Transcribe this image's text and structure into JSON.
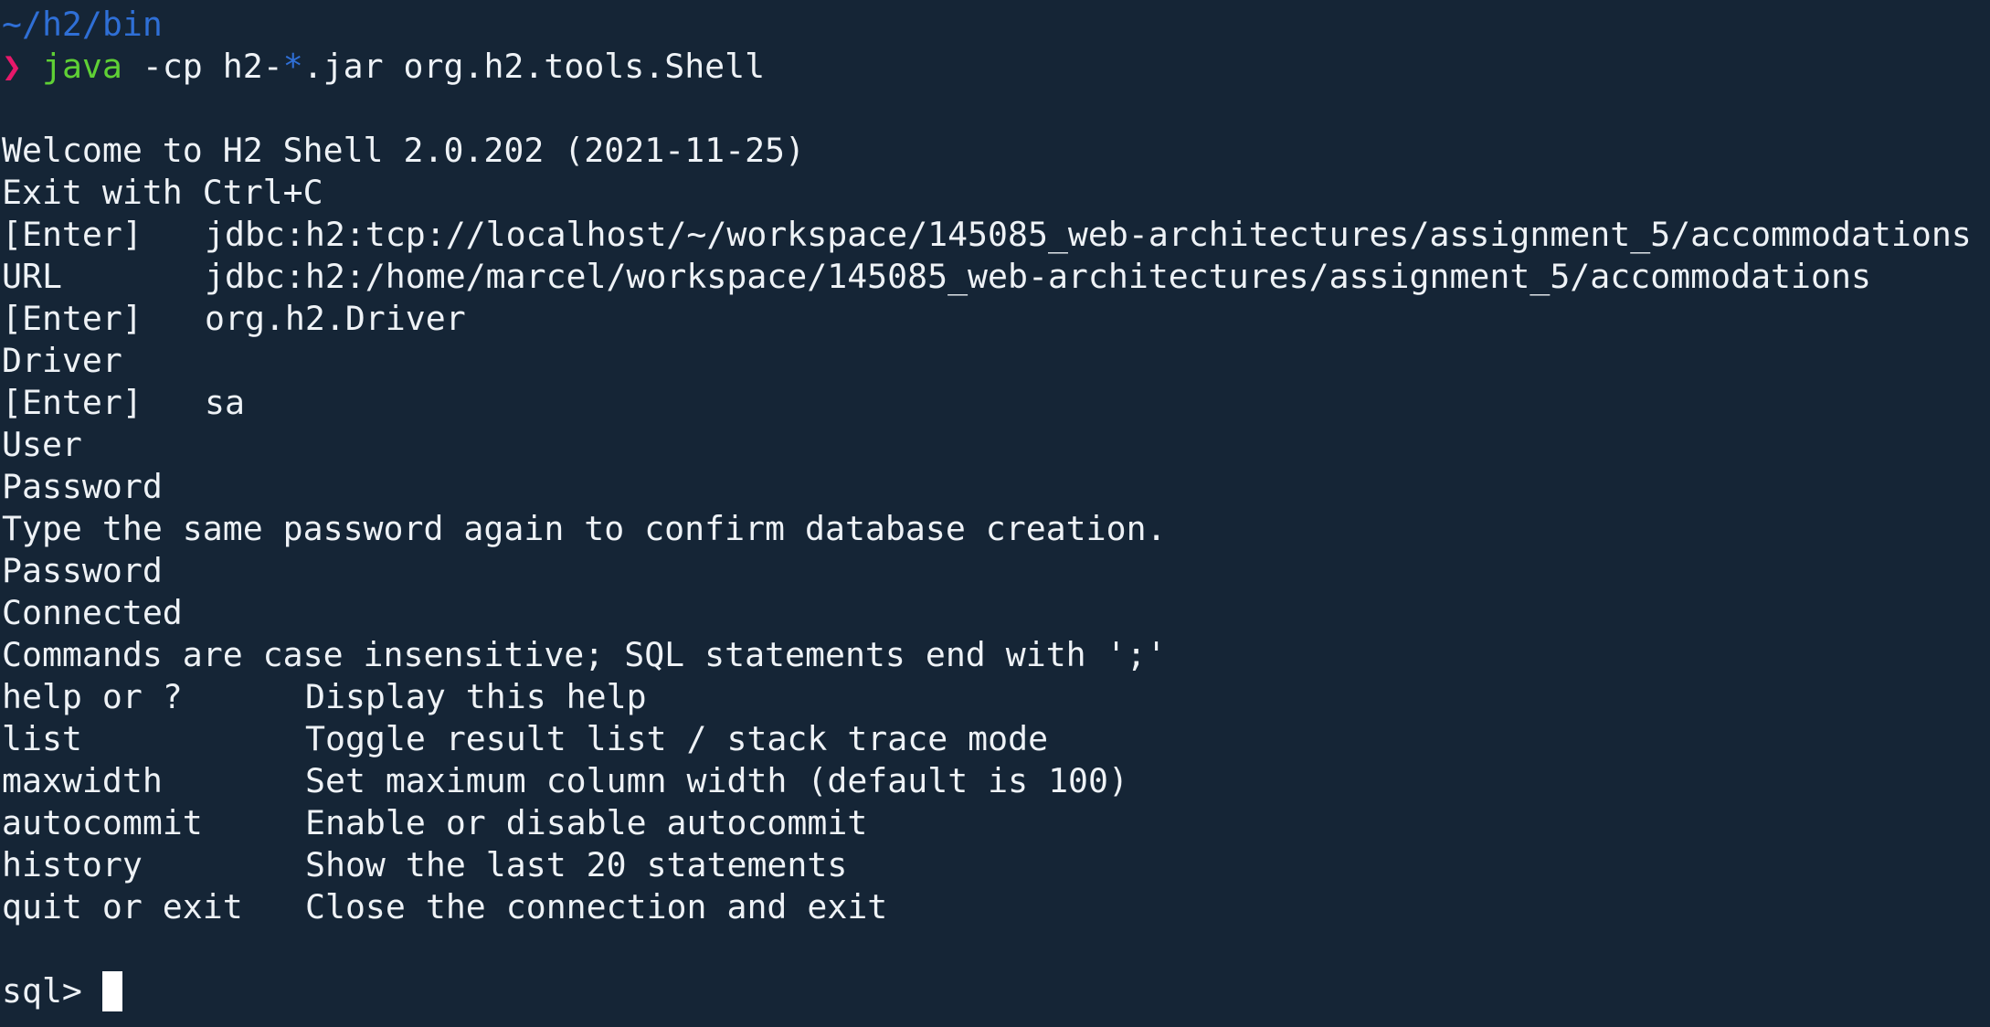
{
  "terminal": {
    "cwd": "~/h2/bin",
    "prompt_symbol": "❯",
    "command": {
      "program": "java",
      "args_before": " -cp h2-",
      "glob": "*",
      "args_after": ".jar org.h2.tools.Shell"
    },
    "output": {
      "welcome": "Welcome to H2 Shell 2.0.202 (2021-11-25)",
      "exit_hint": "Exit with Ctrl+C",
      "prompts": [
        {
          "label": "[Enter]",
          "value": "jdbc:h2:tcp://localhost/~/workspace/145085_web-architectures/assignment_5/accommodations"
        },
        {
          "label": "URL",
          "value": "jdbc:h2:/home/marcel/workspace/145085_web-architectures/assignment_5/accommodations"
        },
        {
          "label": "[Enter]",
          "value": "org.h2.Driver"
        },
        {
          "label": "Driver",
          "value": ""
        },
        {
          "label": "[Enter]",
          "value": "sa"
        },
        {
          "label": "User",
          "value": ""
        },
        {
          "label": "Password",
          "value": ""
        }
      ],
      "confirm_msg": "Type the same password again to confirm database creation.",
      "password2": "Password",
      "connected": "Connected",
      "commands_intro": "Commands are case insensitive; SQL statements end with ';'",
      "help_rows": [
        {
          "cmd": "help or ?",
          "desc": "Display this help"
        },
        {
          "cmd": "list",
          "desc": "Toggle result list / stack trace mode"
        },
        {
          "cmd": "maxwidth",
          "desc": "Set maximum column width (default is 100)"
        },
        {
          "cmd": "autocommit",
          "desc": "Enable or disable autocommit"
        },
        {
          "cmd": "history",
          "desc": "Show the last 20 statements"
        },
        {
          "cmd": "quit or exit",
          "desc": "Close the connection and exit"
        }
      ]
    },
    "sql_prompt": "sql> "
  },
  "colors": {
    "background": "#152536",
    "foreground": "#eef2f6",
    "path_blue": "#2f6fd6",
    "command_green": "#5fd035",
    "prompt_pink": "#e7186a"
  }
}
